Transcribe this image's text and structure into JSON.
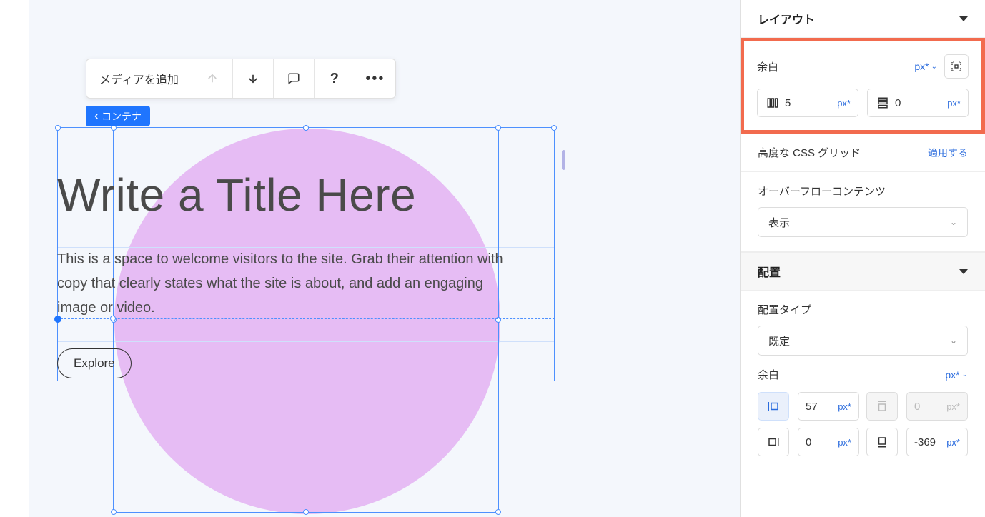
{
  "toolbar": {
    "add_media": "メディアを追加"
  },
  "breadcrumb": {
    "container": "コンテナ"
  },
  "canvas": {
    "title": "Write a Title Here",
    "body": "This is a space to welcome visitors to the site. Grab their attention with copy that clearly states what the site is about, and add an engaging image or video.",
    "explore": "Explore"
  },
  "panel": {
    "layout_header": "レイアウト",
    "margin_label": "余白",
    "unit_px": "px*",
    "gap_h_value": "5",
    "gap_v_value": "0",
    "css_grid_label": "高度な CSS グリッド",
    "apply": "適用する",
    "overflow_label": "オーバーフローコンテンツ",
    "overflow_value": "表示",
    "placement_header": "配置",
    "placement_type_label": "配置タイプ",
    "placement_type_value": "既定",
    "margin_label2": "余白",
    "margin_left": "57",
    "margin_top": "0",
    "margin_right": "0",
    "margin_bottom": "-369"
  }
}
